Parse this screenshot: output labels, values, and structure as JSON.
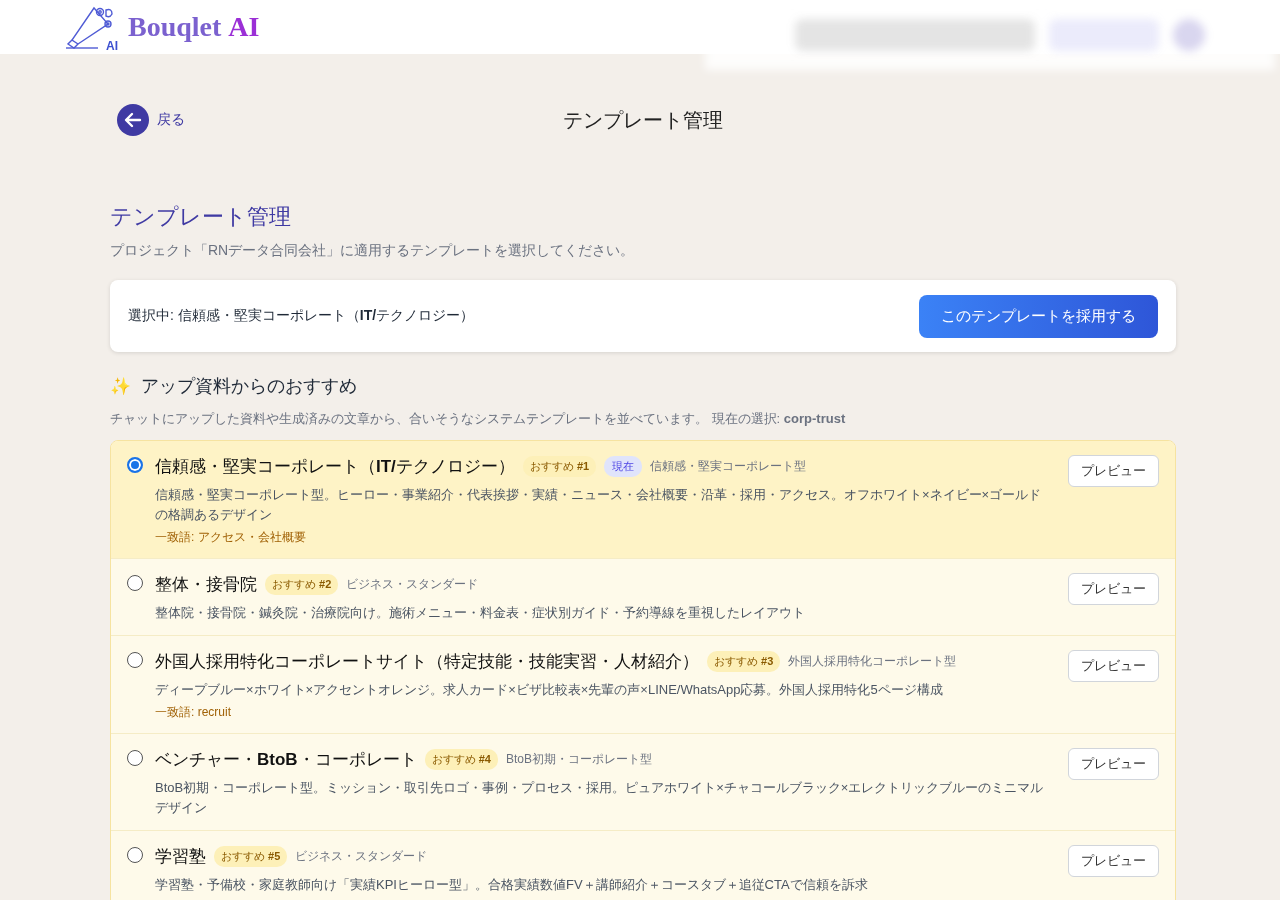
{
  "header": {
    "brand": "Bouqlet",
    "brand_suffix": "AI",
    "logo_badge": "AI"
  },
  "nav": {
    "back_label": "戻る",
    "page_title": "テンプレート管理"
  },
  "heading": {
    "title": "テンプレート管理",
    "description": "プロジェクト「RNデータ合同会社」に適用するテンプレートを選択してください。"
  },
  "selection_bar": {
    "text": "選択中: 信頼感・堅実コーポレート（**IT/**テクノロジー）",
    "button": "このテンプレートを採用する"
  },
  "recommendations": {
    "icon": "✨",
    "title": "アップ資料からのおすすめ",
    "note": "チャットにアップした資料や生成済みの文章から、合いそうなシステムテンプレートを並べています。 現在の選択: **corp-trust**",
    "items": [
      {
        "title": "信頼感・堅実コーポレート（**IT/**テクノロジー）",
        "rank": "おすすめ **#1**",
        "current": "現在",
        "category": "信頼感・堅実コーポレート型",
        "description": "信頼感・堅実コーポレート型。ヒーロー・事業紹介・代表挨拶・実績・ニュース・会社概要・沿革・採用・アクセス。オフホワイト×ネイビー×ゴールドの格調あるデザイン",
        "match": "一致語: アクセス・会社概要",
        "selected": true,
        "preview": "プレビュー"
      },
      {
        "title": "整体・接骨院",
        "rank": "おすすめ **#2**",
        "category": "ビジネス・スタンダード",
        "description": "整体院・接骨院・鍼灸院・治療院向け。施術メニュー・料金表・症状別ガイド・予約導線を重視したレイアウト",
        "selected": false,
        "preview": "プレビュー"
      },
      {
        "title": "外国人採用特化コーポレートサイト（特定技能・技能実習・人材紹介）",
        "rank": "おすすめ **#3**",
        "category": "外国人採用特化コーポレート型",
        "description": "ディープブルー×ホワイト×アクセントオレンジ。求人カード×ビザ比較表×先輩の声×LINE/WhatsApp応募。外国人採用特化5ページ構成",
        "match": "一致語: recruit",
        "selected": false,
        "preview": "プレビュー"
      },
      {
        "title": "ベンチャー・**BtoB**・コーポレート",
        "rank": "おすすめ **#4**",
        "category": "BtoB初期・コーポレート型",
        "description": "BtoB初期・コーポレート型。ミッション・取引先ロゴ・事例・プロセス・採用。ピュアホワイト×チャコールブラック×エレクトリックブルーのミニマルデザイン",
        "selected": false,
        "preview": "プレビュー"
      },
      {
        "title": "学習塾",
        "rank": "おすすめ **#5**",
        "category": "ビジネス・スタンダード",
        "description": "学習塾・予備校・家庭教師向け「実績KPIヒーロー型」。合格実績数値FV＋講師紹介＋コースタブ＋追従CTAで信頼を訴求",
        "selected": false,
        "preview": "プレビュー"
      }
    ]
  }
}
